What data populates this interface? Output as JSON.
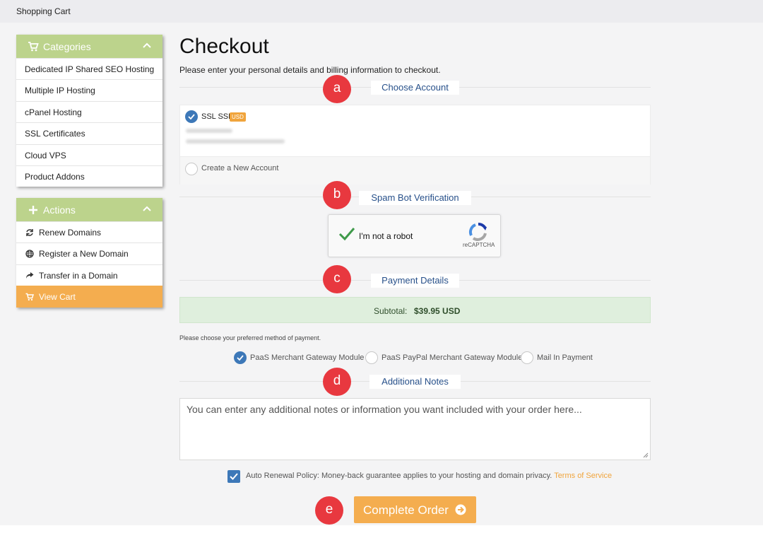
{
  "window": {
    "title": "Shopping Cart"
  },
  "sidebar": {
    "categories": {
      "title": "Categories",
      "items": [
        {
          "label": "Dedicated IP Shared SEO Hosting"
        },
        {
          "label": "Multiple IP Hosting"
        },
        {
          "label": "cPanel Hosting"
        },
        {
          "label": "SSL Certificates"
        },
        {
          "label": "Cloud VPS"
        },
        {
          "label": "Product Addons"
        }
      ]
    },
    "actions": {
      "title": "Actions",
      "items": [
        {
          "label": "Renew Domains",
          "icon": "refresh-icon"
        },
        {
          "label": "Register a New Domain",
          "icon": "globe-icon"
        },
        {
          "label": "Transfer in a Domain",
          "icon": "share-arrow-icon"
        },
        {
          "label": "View Cart",
          "icon": "cart-icon",
          "active": true
        }
      ]
    }
  },
  "main": {
    "title": "Checkout",
    "intro": "Please enter your personal details and billing information to checkout.",
    "sections": {
      "account": "Choose Account",
      "spam": "Spam Bot Verification",
      "payment": "Payment Details",
      "notes": "Additional Notes"
    },
    "markers": [
      "a",
      "b",
      "c",
      "d",
      "e"
    ],
    "account": {
      "selected_name": "SSL SSL",
      "currency_badge": "USD",
      "new_account_label": "Create a New Account"
    },
    "captcha": {
      "label": "I'm not a robot",
      "brand": "reCAPTCHA"
    },
    "payment": {
      "subtotal_label": "Subtotal:",
      "subtotal_value": "$39.95 USD",
      "instruction": "Please choose your preferred method of payment.",
      "options": [
        {
          "label": "PaaS Merchant Gateway Module",
          "selected": true
        },
        {
          "label": "PaaS PayPal Merchant Gateway Module",
          "selected": false
        },
        {
          "label": "Mail In Payment",
          "selected": false
        }
      ]
    },
    "notes_placeholder": "You can enter any additional notes or information you want included with your order here...",
    "policy": {
      "text": "Auto Renewal Policy: Money-back guarantee applies to your hosting and domain privacy.",
      "link": "Terms of Service",
      "checked": true
    },
    "complete_button": "Complete Order"
  },
  "colors": {
    "accent_green": "#bcd38c",
    "accent_orange": "#f4ad4f",
    "marker_red": "#e8383f",
    "link_blue": "#27508a"
  }
}
